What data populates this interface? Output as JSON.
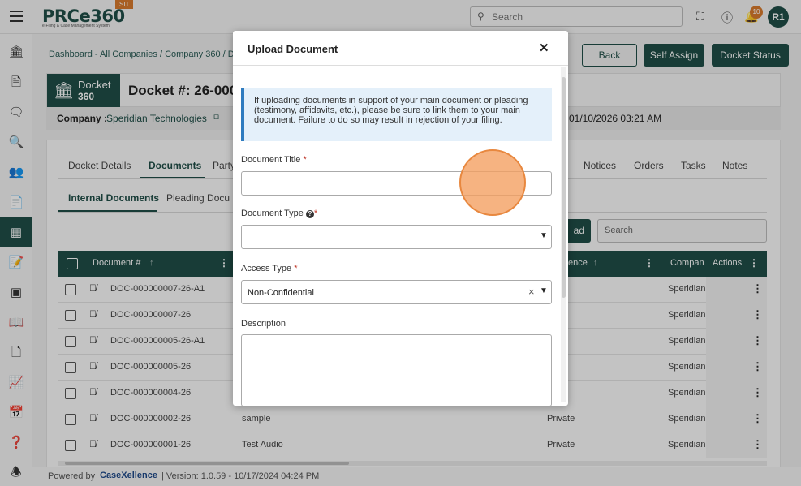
{
  "app": {
    "logo": "PRCe360",
    "logo_sub": "e-Filing & Case Management System",
    "env_badge": "SIT",
    "search_placeholder": "Search",
    "notification_count": "10",
    "user_initials": "R1"
  },
  "sidebar": {
    "icons": [
      "bank-icon",
      "document-icon",
      "chat-icon",
      "search-document-icon",
      "users-icon",
      "file-icon",
      "building-icon",
      "note-icon",
      "scan-icon",
      "book-icon",
      "page-icon",
      "chart-icon",
      "calendar-icon",
      "help-book-icon",
      "bell-icon"
    ],
    "active_index": 6
  },
  "breadcrumb": "Dashboard - All Companies / Company 360 / D",
  "actions": {
    "back": "Back",
    "self_assign": "Self Assign",
    "docket_status": "Docket Status"
  },
  "docket": {
    "badge_line1": "Docket",
    "badge_line2": "360",
    "title": "Docket #: 26-0000",
    "company_label": "Company :",
    "company_value": "Speridian Technologies",
    "date": "01/10/2026 03:21 AM"
  },
  "tabs": {
    "left": [
      "Docket Details",
      "Documents",
      "Party"
    ],
    "right": [
      "Notices",
      "Orders",
      "Tasks",
      "Notes"
    ],
    "active": "Documents"
  },
  "subtabs": [
    "Internal Documents",
    "Pleading Docu"
  ],
  "toolbar": {
    "upload_fragment": "ad",
    "search_placeholder": "Search"
  },
  "table": {
    "headers": {
      "doc": "Document #",
      "confidence": "ence",
      "company": "Compan",
      "actions": "Actions"
    },
    "rows": [
      {
        "doc": "DOC-000000007-26-A1",
        "title": "",
        "conf": "ivate",
        "comp": "Speridian"
      },
      {
        "doc": "DOC-000000007-26",
        "title": "",
        "conf": "ivate",
        "comp": "Speridian"
      },
      {
        "doc": "DOC-000000005-26-A1",
        "title": "",
        "conf": "ivate",
        "comp": "Speridian"
      },
      {
        "doc": "DOC-000000005-26",
        "title": "",
        "conf": "ivate",
        "comp": "Speridian"
      },
      {
        "doc": "DOC-000000004-26",
        "title": "",
        "conf": "ivate",
        "comp": "Speridian"
      },
      {
        "doc": "DOC-000000002-26",
        "title": "sample",
        "conf": "Private",
        "comp": "Speridian"
      },
      {
        "doc": "DOC-000000001-26",
        "title": "Test Audio",
        "conf": "Private",
        "comp": "Speridian"
      }
    ]
  },
  "footer": {
    "powered_by": "Powered by",
    "brand": "CaseXellence",
    "version": "|  Version: 1.0.59 - 10/17/2024 04:24 PM"
  },
  "modal": {
    "title": "Upload Document",
    "info": "If uploading documents in support of your main document or pleading (testimony, affidavits, etc.), please be sure to link them to your main document. Failure to do so may result in rejection of your filing.",
    "document_title_label": "Document Title",
    "document_title_value": "",
    "document_type_label": "Document Type",
    "document_type_value": "",
    "access_type_label": "Access Type",
    "access_type_value": "Non-Confidential",
    "description_label": "Description",
    "required_mark": "*"
  },
  "colors": {
    "brand": "#1f4e47",
    "accent": "#d87a2e",
    "info_bg": "#e4f0fa",
    "info_border": "#2f7cc0"
  }
}
